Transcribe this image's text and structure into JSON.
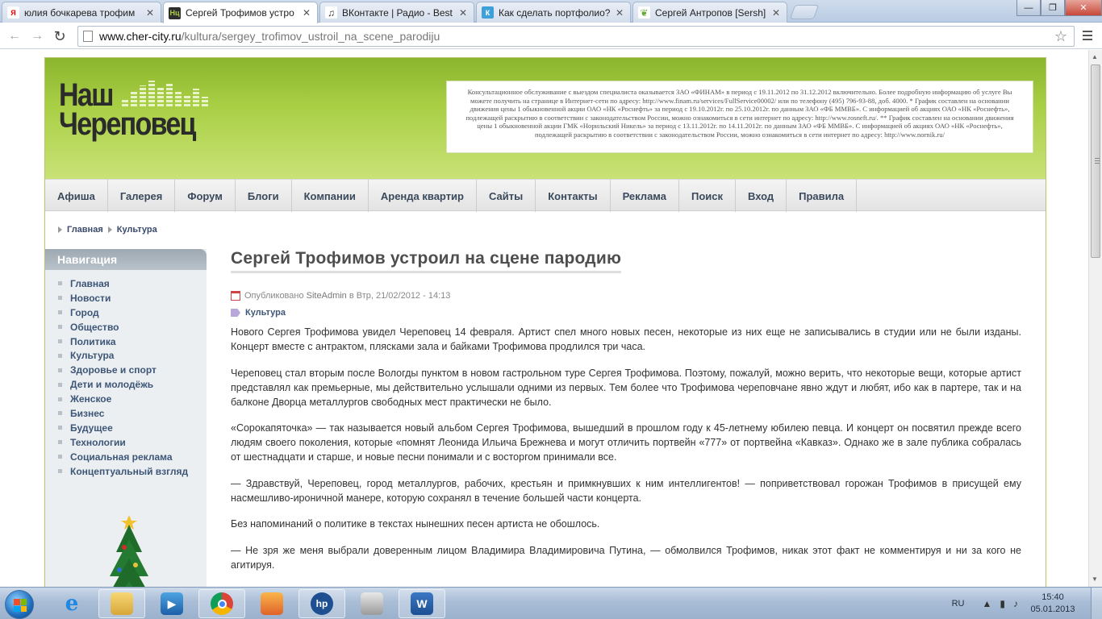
{
  "browser": {
    "tabs": [
      {
        "title": "юлия бочкарева трофим",
        "favicon": "yandex-icon",
        "active": false
      },
      {
        "title": "Сергей Трофимов устро",
        "favicon": "site-nc-icon",
        "active": true
      },
      {
        "title": "ВКонтакте | Радио - Best",
        "favicon": "music-note-icon",
        "active": false
      },
      {
        "title": "Как сделать портфолио?",
        "favicon": "k-icon",
        "active": false
      },
      {
        "title": "Сергей Антропов [Sersh]",
        "favicon": "leaf-icon",
        "active": false
      }
    ],
    "close_glyph": "✕",
    "url_host": "www.cher-city.ru",
    "url_path": "/kultura/sergey_trofimov_ustroil_na_scene_parodiju",
    "back_glyph": "←",
    "forward_glyph": "→",
    "reload_glyph": "↻",
    "star_glyph": "☆",
    "win_min": "—",
    "win_max": "❐",
    "win_close": "✕"
  },
  "site": {
    "logo_line1": "Наш",
    "logo_line2": "Череповец",
    "ad_text": "Консультационное обслуживание с выездом специалиста оказывается ЗАО «ФИНАМ» в период с 19.11.2012 по 31.12.2012 включительно. Более подробную информацию об услуге Вы можете получить на странице в Интернет-сети по адресу: http://www.finam.ru/services/FullService00002/ или по телефону (495) 796-93-88, доб. 4000. * График составлен на основании движения цены 1 обыкновенной акции ОАО «НК «Роснефть» за период с 19.10.2012г. по 25.10.2012г. по данным ЗАО «ФБ ММВБ». С информацией об акциях ОАО «НК «Роснефть», подлежащей раскрытию в соответствии с законодательством России, можно ознакомиться в сети интернет по адресу: http://www.rosneft.ru/. ** График составлен на основании движения цены 1 обыкновенной акции ГМК «Норильский Никель» за период с 13.11.2012г. по 14.11.2012г. по данным ЗАО «ФБ ММВБ». С информацией об акциях ОАО «НК «Роснефть», подлежащей раскрытию в соответствии с законодательством России, можно ознакомиться в сети интернет по адресу: http://www.nornik.ru/",
    "menu": [
      "Афиша",
      "Галерея",
      "Форум",
      "Блоги",
      "Компании",
      "Аренда квартир",
      "Сайты",
      "Контакты",
      "Реклама",
      "Поиск",
      "Вход",
      "Правила"
    ],
    "breadcrumb": [
      "Главная",
      "Культура"
    ],
    "nav_title": "Навигация",
    "nav_items": [
      "Главная",
      "Новости",
      "Город",
      "Общество",
      "Политика",
      "Культура",
      "Здоровье и спорт",
      "Дети и молодёжь",
      "Женское",
      "Бизнес",
      "Будущее",
      "Технологии",
      "Социальная реклама",
      "Концептуальный взгляд"
    ]
  },
  "article": {
    "title": "Сергей Трофимов устроил на сцене пародию",
    "published_prefix": "Опубликовано",
    "author": "SiteAdmin",
    "published_date": "в Втр, 21/02/2012 - 14:13",
    "category": "Культура",
    "paragraphs": [
      "Нового Сергея Трофимова увидел Череповец 14 февраля. Артист спел много новых песен, некоторые из них еще не записывались в студии или не были изданы. Концерт вместе с антрактом, плясками зала и байками Трофимова продлился три часа.",
      "Череповец стал вторым после Вологды пунктом в новом гастрольном туре Сергея Трофимова. Поэтому, пожалуй, можно верить, что некоторые вещи, которые артист представлял как премьерные, мы действительно услышали одними из первых. Тем более что Трофимова череповчане явно ждут и любят, ибо как в партере, так и на балконе Дворца металлургов свободных мест практически не было.",
      "«Сорокапяточка» — так называется новый альбом Сергея Трофимова, вышедший в прошлом году к 45-летнему юбилею певца. И концерт он посвятил прежде всего людям своего поколения, которые «помнят Леонида Ильича Брежнева и могут отличить портвейн «777» от портвейна «Кавказ». Однако же в зале публика собралась от шестнадцати и старше, и новые песни понимали и с восторгом принимали все.",
      "— Здравствуй, Череповец, город металлургов, рабочих, крестьян и примкнувших к ним интеллигентов! — поприветствовал горожан Трофимов в присущей ему насмешливо-ироничной манере, которую сохранял в течение большей части концерта.",
      "Без напоминаний о политике в текстах нынешних песен артиста не обошлось.",
      "— Не зря же меня выбрали доверенным лицом Владимира Владимировича Путина, — обмолвился Трофимов, никак этот факт не комментируя и ни за кого не агитируя."
    ]
  },
  "taskbar": {
    "language": "RU",
    "time": "15:40",
    "date": "05.01.2013",
    "tray_up_glyph": "▲",
    "items": [
      "ie-icon",
      "explorer-icon",
      "media-player-icon",
      "chrome-icon",
      "paint-icon",
      "hp-icon",
      "scanner-icon",
      "word-icon"
    ]
  }
}
